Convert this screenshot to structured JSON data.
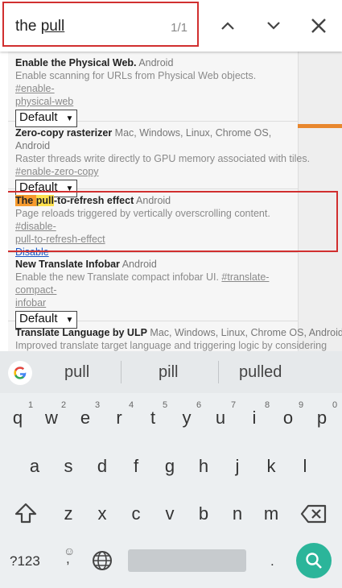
{
  "find": {
    "query_prefix": "the ",
    "query_match": "pull",
    "count": "1/1"
  },
  "experiments": [
    {
      "title": "Enable the Physical Web.",
      "platforms": "Android",
      "desc": "Enable scanning for URLs from Physical Web objects.",
      "link_a": "#enable-",
      "link_b": "physical-web",
      "select": "Default"
    },
    {
      "title": "Zero-copy rasterizer",
      "platforms": "Mac, Windows, Linux, Chrome OS, Android",
      "desc": "Raster threads write directly to GPU memory associated with tiles.",
      "link": "#enable-zero-copy",
      "select": "Default"
    },
    {
      "title_a": "The ",
      "title_b": "pull",
      "title_c": "-to-refresh effect",
      "platforms": "Android",
      "desc": "Page reloads triggered by vertically overscrolling content.",
      "link_a": "#disable-",
      "link_b": "pull-to-refresh-effect",
      "action": "Disable"
    },
    {
      "title": "New Translate Infobar",
      "platforms": "Android",
      "desc": "Enable the new Translate compact infobar UI.",
      "link_a": "#translate-compact-",
      "link_b": "infobar",
      "select": "Default"
    },
    {
      "title": "Translate Language by ULP",
      "platforms": "Mac, Windows, Linux, Chrome OS, Android",
      "desc": "Improved translate target language and triggering logic by considering"
    }
  ],
  "keyboard": {
    "suggestions": [
      "pull",
      "pill",
      "pulled"
    ],
    "row1": [
      "q",
      "w",
      "e",
      "r",
      "t",
      "y",
      "u",
      "i",
      "o",
      "p"
    ],
    "row1_hints": [
      "1",
      "2",
      "3",
      "4",
      "5",
      "6",
      "7",
      "8",
      "9",
      "0"
    ],
    "row2": [
      "a",
      "s",
      "d",
      "f",
      "g",
      "h",
      "j",
      "k",
      "l"
    ],
    "row3": [
      "z",
      "x",
      "c",
      "v",
      "b",
      "n",
      "m"
    ],
    "symbols_label": "?123",
    "emoji_hint": "☺",
    "comma": ",",
    "period": "."
  },
  "colors": {
    "highlight": "#f79b2e",
    "annotation_red": "#d12f2f",
    "search_key": "#2bb59a",
    "link": "#1a55c4"
  }
}
